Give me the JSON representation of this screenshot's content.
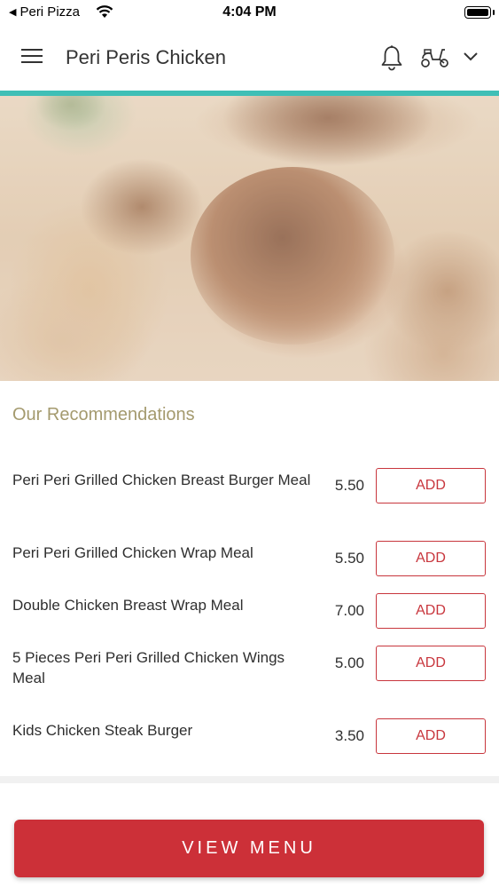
{
  "status_bar": {
    "back_app": "Peri Pizza",
    "time": "4:04 PM"
  },
  "header": {
    "title": "Peri Peris Chicken",
    "icons": [
      "menu-icon",
      "bell-icon",
      "scooter-icon",
      "chevron-down-icon"
    ]
  },
  "colors": {
    "accent": "#3fbfb6",
    "brand_red": "#cc3038",
    "section_title": "#a49a6e"
  },
  "recommendations": {
    "title": "Our Recommendations",
    "items": [
      {
        "name": "Peri Peri Grilled Chicken Breast Burger Meal",
        "price": "5.50",
        "button": "ADD"
      },
      {
        "name": "Peri Peri Grilled Chicken Wrap Meal",
        "price": "5.50",
        "button": "ADD"
      },
      {
        "name": "Double Chicken Breast Wrap Meal",
        "price": "7.00",
        "button": "ADD"
      },
      {
        "name": "5 Pieces Peri Peri Grilled Chicken Wings Meal",
        "price": "5.00",
        "button": "ADD"
      },
      {
        "name": "Kids Chicken Steak Burger",
        "price": "3.50",
        "button": "ADD"
      }
    ]
  },
  "footer": {
    "view_menu_label": "VIEW MENU"
  }
}
